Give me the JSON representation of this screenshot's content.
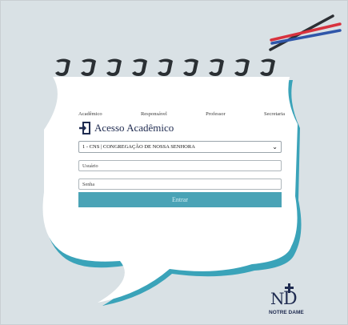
{
  "tabs": [
    "Acadêmico",
    "Responsável",
    "Professor",
    "Secretaria"
  ],
  "title": "Acesso Acadêmico",
  "school_select": "1 - CNS | CONGREGAÇÃO DE NOSSA SENHORA",
  "user_placeholder": "Usuário",
  "password_placeholder": "Senha",
  "submit_label": "Entrar",
  "logo_text": "NOTRE DAME",
  "colors": {
    "accent": "#4aa3b6",
    "navy": "#1f2b50",
    "background": "#d9e1e5"
  }
}
